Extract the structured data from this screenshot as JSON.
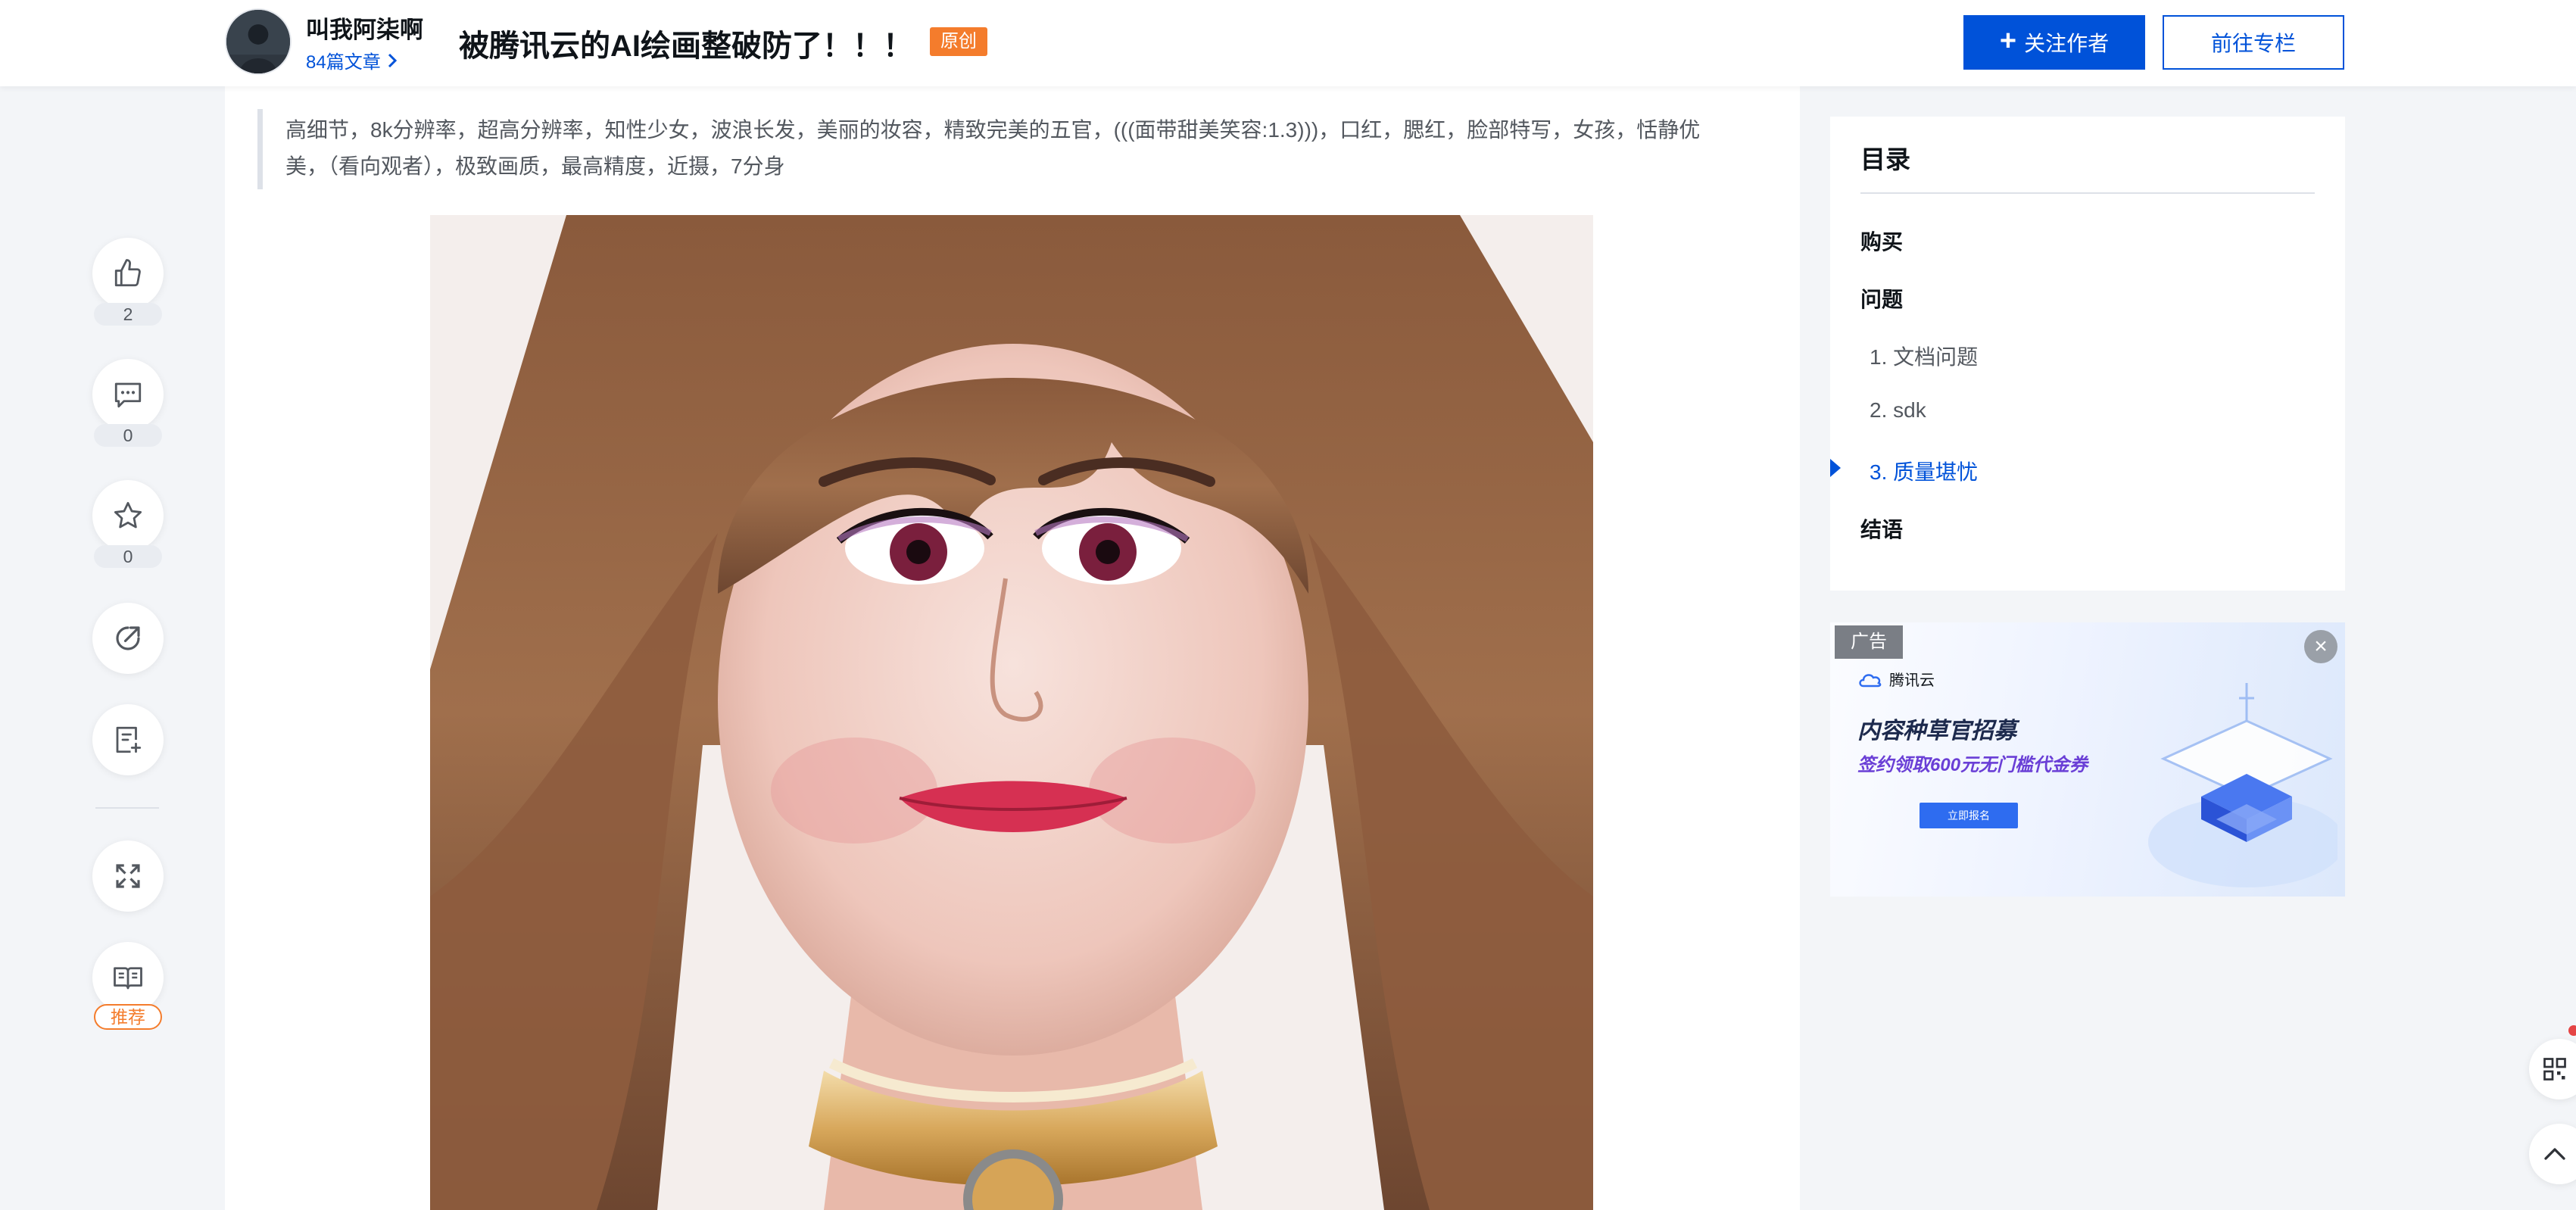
{
  "header": {
    "author_name": "叫我阿柒啊",
    "author_articles": "84篇文章",
    "article_title": "被腾讯云的AI绘画整破防了！！！",
    "original_badge": "原创",
    "follow_label": "关注作者",
    "column_label": "前往专栏"
  },
  "article": {
    "clipped_text": "……………………………",
    "prompt_quote": "高细节，8k分辨率，超高分辨率，知性少女，波浪长发，美丽的妆容，精致完美的五官，(((面带甜美笑容:1.3)))，口红，腮红，脸部特写，女孩，恬静优美，（看向观者），极致画质，最高精度，近摄，7分身",
    "image_alt": "AI generated portrait of a smiling girl with long wavy brown hair"
  },
  "side_actions": {
    "like_count": "2",
    "comment_count": "0",
    "favorite_count": "0",
    "recommend_label": "推荐"
  },
  "toc": {
    "title": "目录",
    "items": [
      {
        "label": "购买",
        "level": 1
      },
      {
        "label": "问题",
        "level": 1
      },
      {
        "label": "1. 文档问题",
        "level": 2
      },
      {
        "label": "2. sdk",
        "level": 2
      },
      {
        "label": "3. 质量堪忧",
        "level": 2,
        "active": true
      },
      {
        "label": "结语",
        "level": 1
      }
    ]
  },
  "ad": {
    "tag": "广告",
    "brand": "腾讯云",
    "headline": "内容种草官招募",
    "subline": "签约领取600元无门槛代金券",
    "cta": "立即报名"
  },
  "colors": {
    "brand_blue": "#0052d9",
    "original_orange": "#f47c2c",
    "page_bg": "#f3f5f8"
  }
}
